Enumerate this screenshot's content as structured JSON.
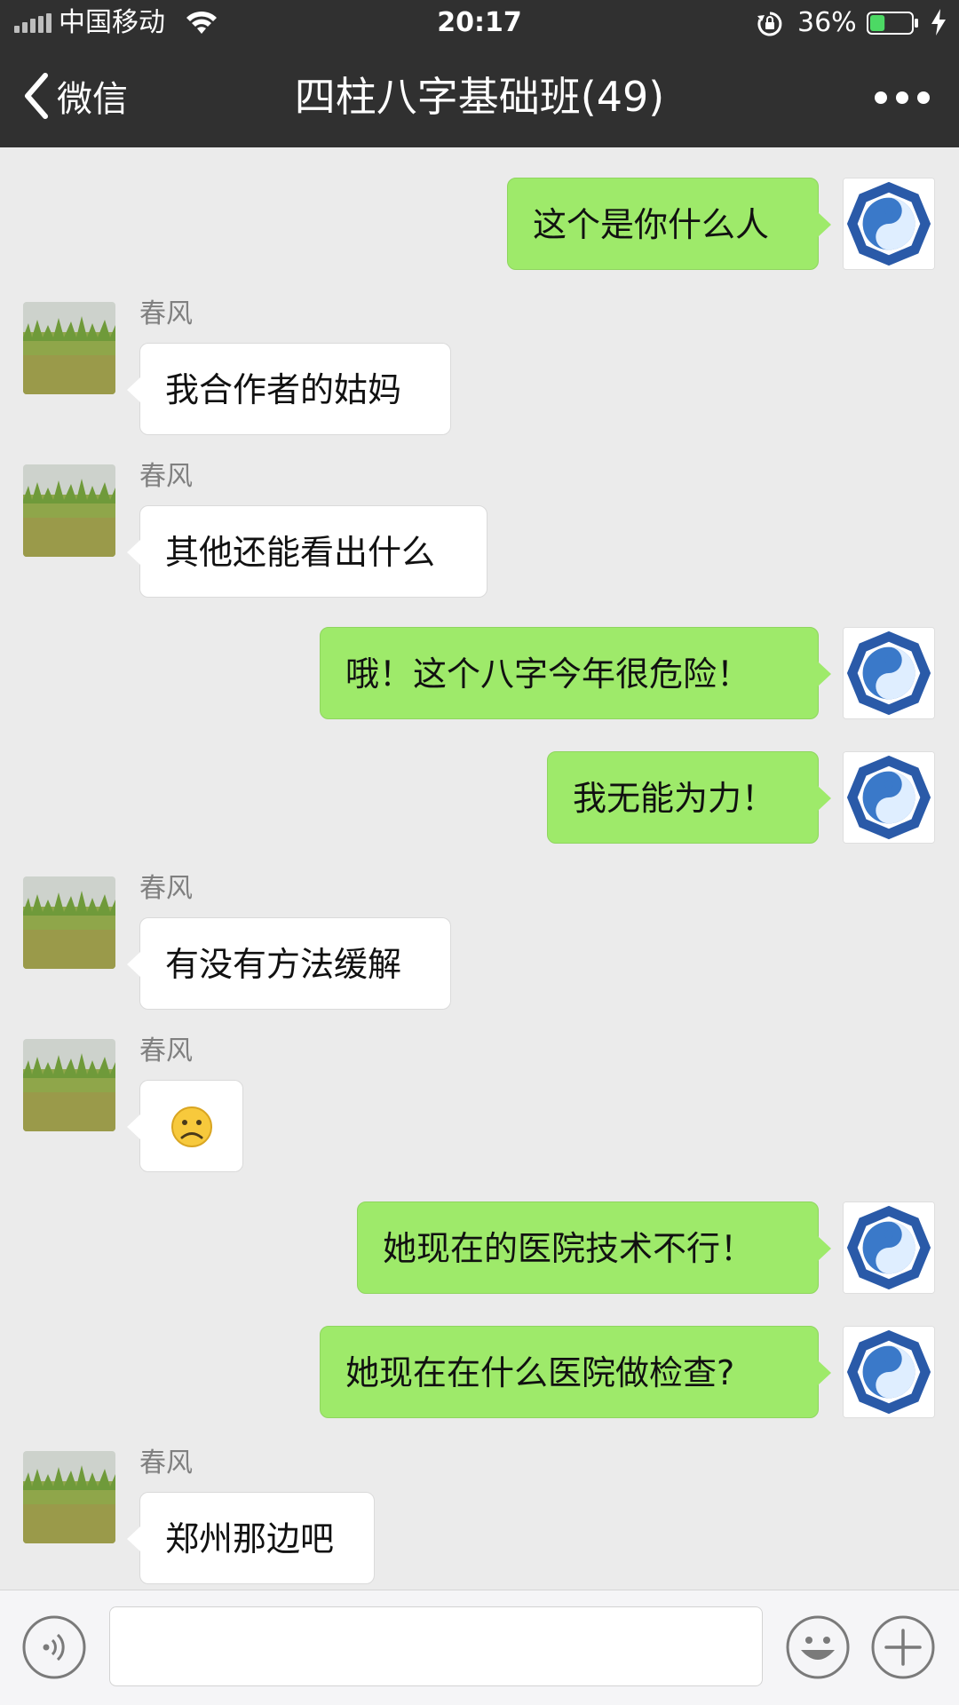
{
  "status_bar": {
    "carrier": "中国移动",
    "time": "20:17",
    "battery": "36%",
    "battery_level": 0.36,
    "icons": [
      "signal-icon",
      "wifi-icon",
      "rotation-lock-icon",
      "battery-icon",
      "charging-icon"
    ]
  },
  "nav": {
    "back_label": "微信",
    "title": "四柱八字基础班(49)",
    "more_icon": "more-dots-icon"
  },
  "colors": {
    "header_bg": "#303030",
    "chat_bg": "#ebebeb",
    "my_bubble": "#9eea6a",
    "other_bubble": "#ffffff"
  },
  "messages": [
    {
      "side": "right",
      "text": "这个是你什么人"
    },
    {
      "side": "left",
      "sender": "春风",
      "text": "我合作者的姑妈"
    },
    {
      "side": "left",
      "sender": "春风",
      "text": "其他还能看出什么"
    },
    {
      "side": "right",
      "text": "哦！这个八字今年很危险！"
    },
    {
      "side": "right",
      "text": "我无能为力！"
    },
    {
      "side": "left",
      "sender": "春风",
      "text": "有没有方法缓解"
    },
    {
      "side": "left",
      "sender": "春风",
      "text": "☹",
      "emoji": "frowning-face-emoji"
    },
    {
      "side": "right",
      "text": "她现在的医院技术不行！"
    },
    {
      "side": "right",
      "text": "她现在在什么医院做检查?"
    },
    {
      "side": "left",
      "sender": "春风",
      "text": "郑州那边吧"
    }
  ],
  "input": {
    "value": "",
    "voice_icon": "voice-icon",
    "emoji_icon": "emoji-icon",
    "plus_icon": "plus-icon"
  }
}
